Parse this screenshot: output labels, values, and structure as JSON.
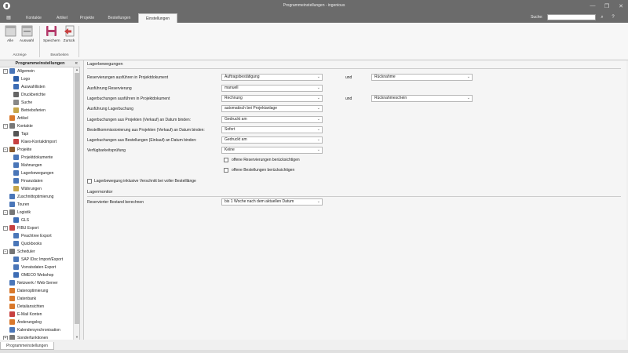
{
  "window": {
    "title": "Programmeinstellungen - ingenious",
    "controls": [
      "—",
      "❐",
      "✕"
    ]
  },
  "ribbon": {
    "tabs": [
      "Kontakte",
      "Artikel",
      "Projekte",
      "Bestellungen",
      "Einstellungen"
    ],
    "active_tab": "Einstellungen",
    "search_label": "Suche:",
    "search_value": "",
    "buttons": {
      "alle": "Alle",
      "auswahl": "Auswahl",
      "speichern": "Speichern",
      "zurueck": "Zurück"
    },
    "groups": {
      "anzeige": "Anzeige",
      "bearbeiten": "Bearbeiten"
    }
  },
  "sidebar": {
    "header": "Programmeinstellungen",
    "collapse_icon": "«",
    "bottom_tab": "Programmeinstellungen",
    "tree": [
      {
        "label": "Allgemein",
        "level": 0,
        "exp": "−",
        "icon": "#4a76b8"
      },
      {
        "label": "Logo",
        "level": 1,
        "icon": "#2a5ca8"
      },
      {
        "label": "Auswahllisten",
        "level": 1,
        "icon": "#3d6db5"
      },
      {
        "label": "Druckberichte",
        "level": 1,
        "icon": "#666"
      },
      {
        "label": "Suche",
        "level": 1,
        "icon": "#888"
      },
      {
        "label": "Betriebsferien",
        "level": 1,
        "icon": "#c7a64a"
      },
      {
        "label": "Artikel",
        "level": 0,
        "icon": "#d9782b"
      },
      {
        "label": "Kontakte",
        "level": 0,
        "exp": "−",
        "icon": "#777"
      },
      {
        "label": "Tapi",
        "level": 1,
        "icon": "#555"
      },
      {
        "label": "Klaes-Kontaktimport",
        "level": 1,
        "icon": "#c74040"
      },
      {
        "label": "Projekte",
        "level": 0,
        "exp": "−",
        "icon": "#8a5a2e"
      },
      {
        "label": "Projektdokumente",
        "level": 1,
        "icon": "#4a76b8"
      },
      {
        "label": "Mahnungen",
        "level": 1,
        "icon": "#4a76b8"
      },
      {
        "label": "Lagerbewegungen",
        "level": 1,
        "icon": "#4a76b8"
      },
      {
        "label": "Finanzdaten",
        "level": 1,
        "icon": "#4a76b8"
      },
      {
        "label": "Währungen",
        "level": 1,
        "icon": "#c7a64a"
      },
      {
        "label": "Zuschnittoptimierung",
        "level": 0,
        "icon": "#4a76b8"
      },
      {
        "label": "Touren",
        "level": 0,
        "icon": "#4a76b8"
      },
      {
        "label": "Logistik",
        "level": 0,
        "exp": "−",
        "icon": "#777"
      },
      {
        "label": "GLS",
        "level": 1,
        "icon": "#3d6db5"
      },
      {
        "label": "FIBU Export",
        "level": 0,
        "exp": "−",
        "icon": "#c74040"
      },
      {
        "label": "Peachtree Export",
        "level": 1,
        "icon": "#4a76b8"
      },
      {
        "label": "Quickbooks",
        "level": 1,
        "icon": "#4a76b8"
      },
      {
        "label": "Scheduler",
        "level": 0,
        "exp": "−",
        "icon": "#777"
      },
      {
        "label": "SAP IDoc Import/Export",
        "level": 1,
        "icon": "#4a76b8"
      },
      {
        "label": "Vorratsdaten Export",
        "level": 1,
        "icon": "#4a76b8"
      },
      {
        "label": "OMECO Webshop",
        "level": 1,
        "icon": "#3d6db5"
      },
      {
        "label": "Netzwerk / Web-Server",
        "level": 0,
        "icon": "#4a76b8"
      },
      {
        "label": "Datenoptimierung",
        "level": 0,
        "icon": "#d9782b"
      },
      {
        "label": "Datenbank",
        "level": 0,
        "icon": "#d9782b"
      },
      {
        "label": "Detailansichten",
        "level": 0,
        "icon": "#d9782b"
      },
      {
        "label": "E-Mail Konten",
        "level": 0,
        "icon": "#c74040"
      },
      {
        "label": "Änderungslog",
        "level": 0,
        "icon": "#d9782b"
      },
      {
        "label": "Kalendersynchronisation",
        "level": 0,
        "icon": "#4a76b8"
      },
      {
        "label": "Sonderfunktionen",
        "level": 0,
        "exp": "+",
        "icon": "#777"
      }
    ]
  },
  "lagerbewegungen": {
    "title": "Lagerbewegungen",
    "und": "und",
    "rows": [
      {
        "label": "Reservierungen ausführen in Projektdokument",
        "value": "Auftragsbestätigung",
        "extra": "Rücknahme"
      },
      {
        "label": "Ausführung Reservierung",
        "value": "manuell"
      },
      {
        "label": "Lagerbuchungen ausführen in Projektdokument",
        "value": "Rechnung",
        "extra": "Rücknahmeschein"
      },
      {
        "label": "Ausführung Lagerbuchung",
        "value": "automatisch bei Projektanlage"
      },
      {
        "label": "Lagerbuchungen aus Projekten (Verkauf) an Datum binden:",
        "value": "Gedruckt am"
      },
      {
        "label": "Bestellkommissionierung aus Projekten (Verkauf) an Datum binden:",
        "value": "Sofort"
      },
      {
        "label": "Lagerbuchungen aus Bestellungen (Einkauf) an Datum binden:",
        "value": "Gedruckt am"
      },
      {
        "label": "Verfügbarkeitsprüfung",
        "value": "Keine"
      }
    ],
    "checkboxes": {
      "offene_reservierungen": "offene Reservierungen berücksichtigen",
      "offene_bestellungen": "offene Bestellungen berücksichtigen",
      "inklusive_verschnitt": "Lagerbewegung inklusive Verschnitt bei voller Bestelllänge"
    }
  },
  "lagermonitor": {
    "title": "Lagermonitor",
    "row_label": "Reservierter Bestand berechnen",
    "row_value": "bis 1 Woche nach dem aktuellen Datum"
  }
}
